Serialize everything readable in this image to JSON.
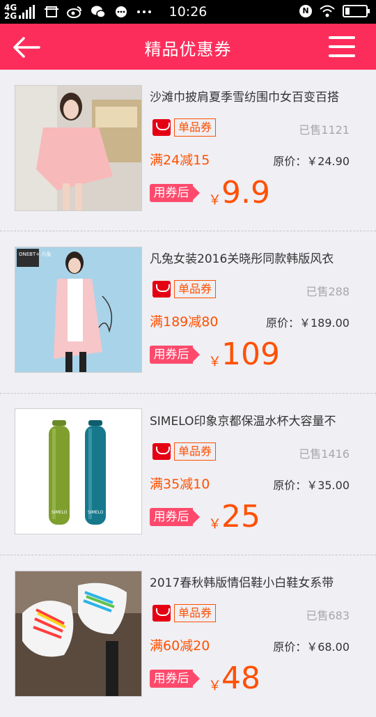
{
  "status_bar": {
    "network_top": "4G",
    "network_bottom": "2G",
    "time": "10:26",
    "nfc_label": "N"
  },
  "header": {
    "title": "精品优惠券"
  },
  "products": [
    {
      "name": "沙滩巾披肩夏季雪纺围巾女百变百搭",
      "badge": "单品券",
      "sold": "已售1121",
      "rule": "满24减15",
      "original": "原价：￥24.90",
      "tag": "用券后",
      "currency": "￥",
      "price": "9.9",
      "image": "pink-chiffon-shawl-model"
    },
    {
      "name": "凡兔女装2016关晓彤同款韩版风衣",
      "badge": "单品券",
      "sold": "已售288",
      "rule": "满189减80",
      "original": "原价：￥189.00",
      "tag": "用券后",
      "currency": "￥",
      "price": "109",
      "image": "pink-trench-coat-model",
      "image_brand": "ONEBT+ 凡兔"
    },
    {
      "name": "SIMELO印象京都保温水杯大容量不",
      "badge": "单品券",
      "sold": "已售1416",
      "rule": "满35减10",
      "original": "原价：￥35.00",
      "tag": "用券后",
      "currency": "￥",
      "price": "25",
      "image": "green-and-teal-thermos-bottles",
      "image_brand": "SIMELO"
    },
    {
      "name": "2017春秋韩版情侣鞋小白鞋女系带",
      "badge": "单品券",
      "sold": "已售683",
      "rule": "满60减20",
      "original": "原价：￥68.00",
      "tag": "用券后",
      "currency": "￥",
      "price": "48",
      "image": "white-sneakers-colorful-laces"
    }
  ],
  "colors": {
    "brand": "#fd2d5b",
    "accent": "#ff5000",
    "tag": "#fd4a6c",
    "background": "#efeff4"
  }
}
